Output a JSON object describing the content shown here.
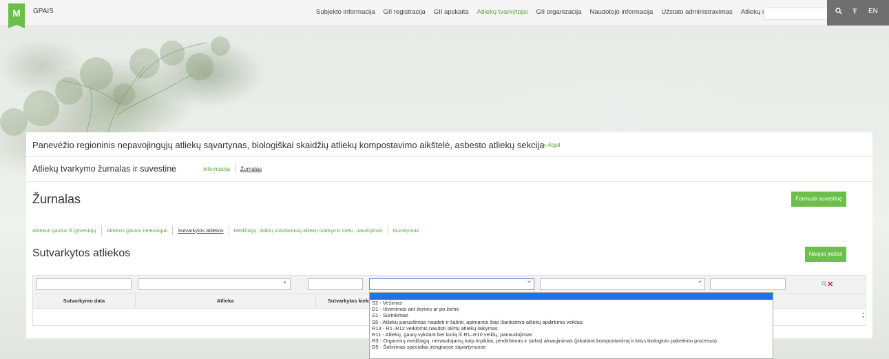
{
  "topbar": {
    "logo_glyph": "M",
    "app_name": "GPAIS",
    "nav": [
      {
        "label": "Subjekto informacija",
        "active": false
      },
      {
        "label": "GII registracija",
        "active": false
      },
      {
        "label": "GII apskaita",
        "active": false
      },
      {
        "label": "Atliekų tvarkytojai",
        "active": true
      },
      {
        "label": "GII organizacija",
        "active": false
      },
      {
        "label": "Naudotojo informacija",
        "active": false
      },
      {
        "label": "Užstato administravimas",
        "active": false
      },
      {
        "label": "Atliekų darytojai",
        "active": false
      }
    ],
    "search_value": "",
    "lang": "EN"
  },
  "header": {
    "title": "Panevėžio regioninis nepavojingųjų atliekų sąvartynas, biologiškai skaidžių atliekų kompostavimo aikštelė, asbesto atliekų sekcija",
    "back_link": "« Atgal",
    "subtitle": "Atliekų tvarkymo žurnalas ir suvestinė",
    "tab_info": "Informacija",
    "tab_journal": "Žurnalas"
  },
  "journal": {
    "heading": "Žurnalas",
    "summary_button": "Formuoti suvestinę",
    "subtabs": [
      {
        "label": "Atliekos gautos iš gyventojų",
        "current": false
      },
      {
        "label": "Atliekos gautos neiesiogiai",
        "current": false
      },
      {
        "label": "Sutvarkytos atliekos",
        "current": true
      },
      {
        "label": "Medžiagų, daiktų susidariusių atliekų tvarkymo metu, naudojimas",
        "current": false
      },
      {
        "label": "Nurašymas",
        "current": false
      }
    ],
    "section_heading": "Sutvarkytos atliekos",
    "new_button": "Naujas įrašas"
  },
  "grid": {
    "columns": [
      "Sutvarkymo data",
      "Atlieka",
      "Sutvarkytas kiekis, t"
    ],
    "filters": {
      "date": "",
      "waste": "",
      "amount": "",
      "method": "",
      "extra_select": "",
      "extra_text": ""
    }
  },
  "dropdown": {
    "highlighted": "",
    "options": [
      "S2 - Vežimas",
      "D1 - Išvertimas ant žemės ar po žeme",
      "S1 - Surinkimas",
      "S5 - Atliekų paruošimas naudoti ir šalinti, apimantis šias išankstinio atliekų apdirbimo veiklas:",
      "R13 - R1–R12 veiklomis naudoti skirtų atliekų laikymas",
      "R11 - Atliekų, gautų vykdant bet kurią iš R1–R10 veiklų, panaudojimas",
      "R3 - Organinių medžiagų, nenaudojamų kaip tirpikliai, perdirbimas ir (arba) atnaujinimas (įskaitant kompostavimą ir kitus biologinio pakeitimo procesus)",
      "D5 - Šalinimas specialiai įrengtuose sąvartynuose"
    ]
  },
  "colors": {
    "accent": "#6bbf4a",
    "link": "#5aa83c",
    "delete": "#dd2222",
    "highlight": "#1e73e8"
  }
}
